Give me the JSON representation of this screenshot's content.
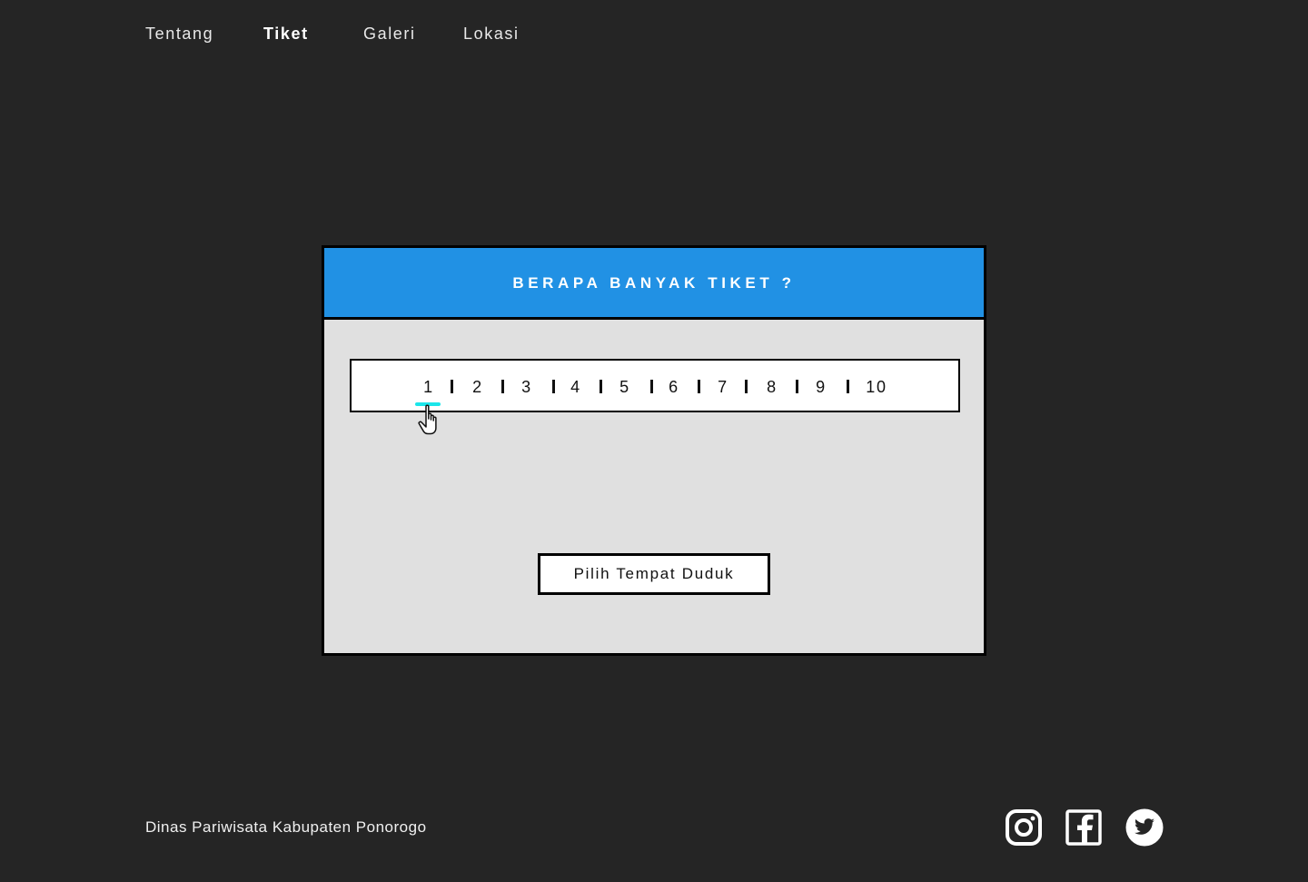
{
  "nav": {
    "items": [
      {
        "label": "Tentang",
        "active": false
      },
      {
        "label": "Tiket",
        "active": true
      },
      {
        "label": "Galeri",
        "active": false
      },
      {
        "label": "Lokasi",
        "active": false
      }
    ]
  },
  "modal": {
    "title": "BERAPA BANYAK TIKET ?",
    "options": [
      "1",
      "2",
      "3",
      "4",
      "5",
      "6",
      "7",
      "8",
      "9",
      "10"
    ],
    "selected": "1",
    "button_label": "Pilih Tempat Duduk"
  },
  "footer": {
    "text": "Dinas Pariwisata Kabupaten Ponorogo",
    "social": [
      {
        "icon": "instagram-icon"
      },
      {
        "icon": "facebook-icon"
      },
      {
        "icon": "twitter-icon"
      }
    ]
  },
  "colors": {
    "background": "#252525",
    "header_blue": "#2191e4",
    "panel_gray": "#e0e0e0",
    "selection_cyan": "#1be6ea"
  }
}
